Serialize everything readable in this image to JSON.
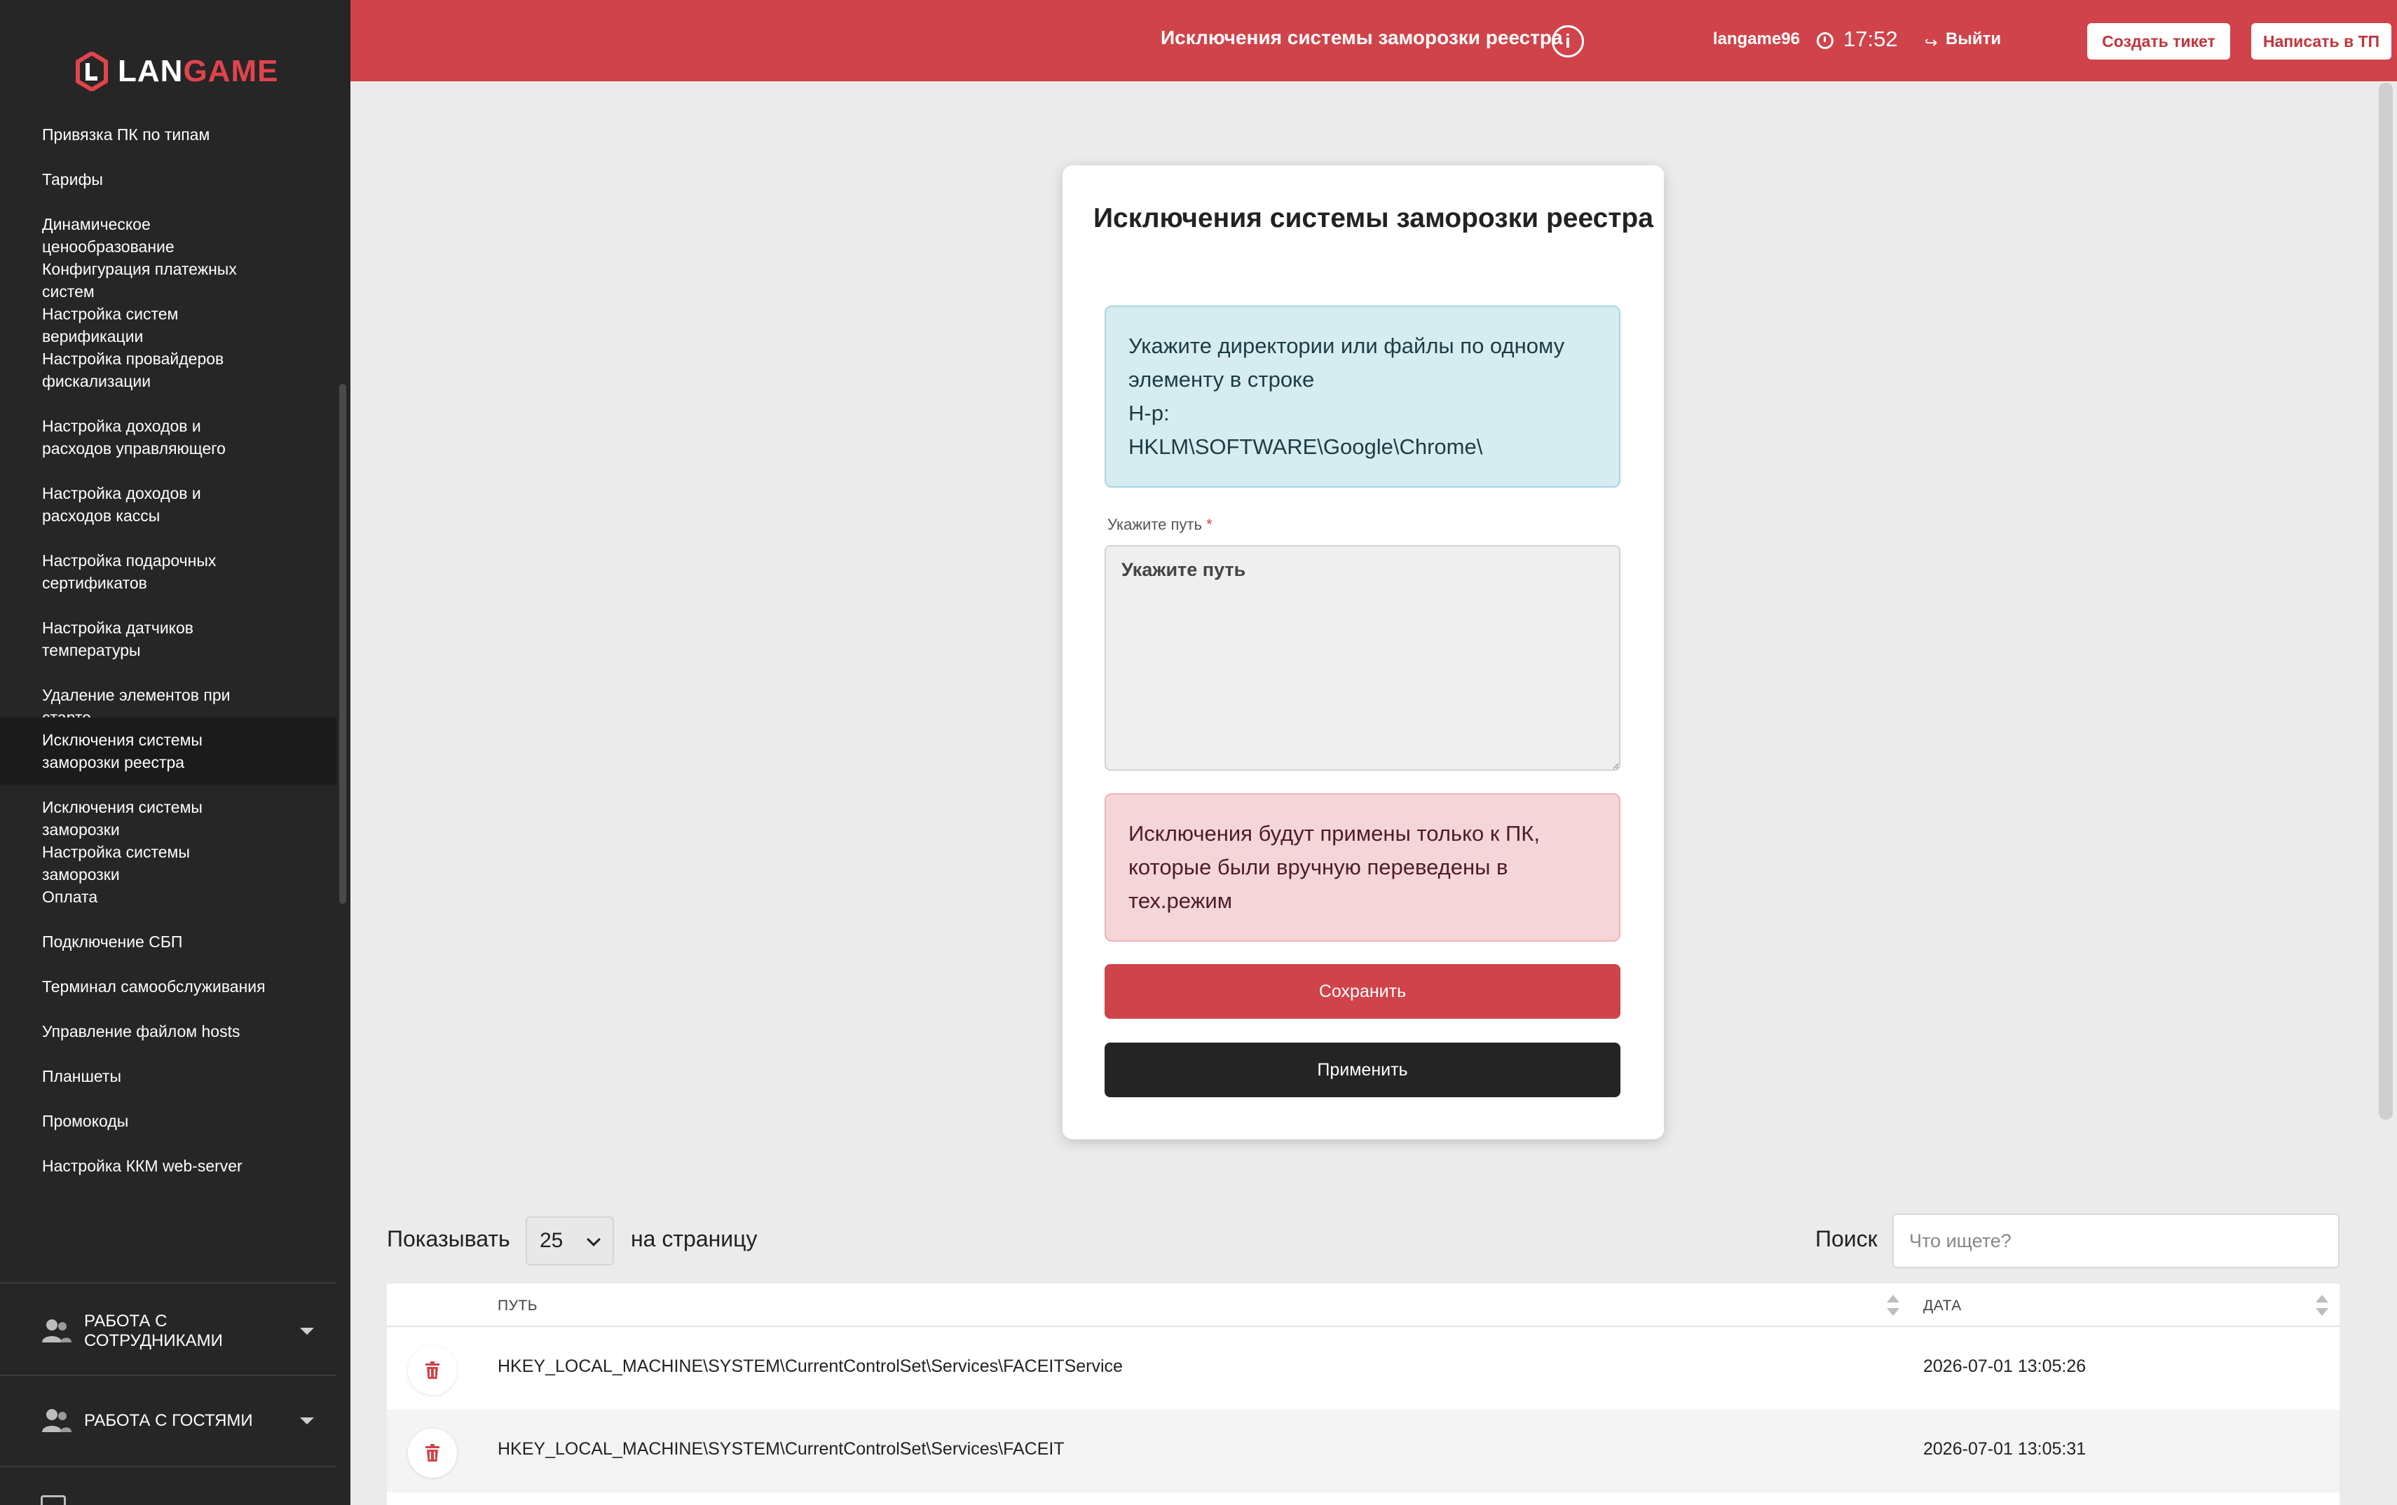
{
  "brand": {
    "logo_text_main": "LAN",
    "logo_text_accent": "GAME",
    "accent_color": "#d0434a"
  },
  "sidebar": {
    "items": [
      {
        "label": "Привязка ПК по типам",
        "active": false
      },
      {
        "label": "Тарифы",
        "active": false
      },
      {
        "label": "Динамическое ценообразование",
        "active": false
      },
      {
        "label": "Конфигурация платежных систем",
        "active": false
      },
      {
        "label": "Настройка систем верификации",
        "active": false
      },
      {
        "label": "Настройка провайдеров фискализации",
        "active": false
      },
      {
        "label": "Настройка доходов и расходов управляющего",
        "active": false
      },
      {
        "label": "Настройка доходов и расходов кассы",
        "active": false
      },
      {
        "label": "Настройка подарочных сертификатов",
        "active": false
      },
      {
        "label": "Настройка датчиков температуры",
        "active": false
      },
      {
        "label": "Удаление элементов при старте",
        "active": false
      },
      {
        "label": "Исключения системы заморозки реестра",
        "active": true
      },
      {
        "label": "Исключения системы заморозки",
        "active": false
      },
      {
        "label": "Настройка системы заморозки",
        "active": false
      },
      {
        "label": "Оплата",
        "active": false
      },
      {
        "label": "Подключение СБП",
        "active": false
      },
      {
        "label": "Терминал самообслуживания",
        "active": false
      },
      {
        "label": "Управление файлом hosts",
        "active": false
      },
      {
        "label": "Планшеты",
        "active": false
      },
      {
        "label": "Промокоды",
        "active": false
      },
      {
        "label": "Настройка ККМ web-server",
        "active": false
      }
    ],
    "sections": [
      {
        "label": "Работа с сотрудниками",
        "icon": "people-icon"
      },
      {
        "label": "Работа с гостями",
        "icon": "people-icon"
      }
    ]
  },
  "header": {
    "title": "Исключения системы заморозки реестра",
    "create_ticket_label": "Создать тикет",
    "write_support_label": "Написать в ТП",
    "username": "langame96",
    "time": "17:52",
    "logout_label": "Выйти"
  },
  "form": {
    "title": "Исключения системы заморозки реестра",
    "info_lines": [
      "Укажите директории или файлы по одному",
      "элементу в строке",
      "Н-р:",
      "HKLM\\SOFTWARE\\Google\\Chrome\\"
    ],
    "path_label": "Укажите путь",
    "path_required_mark": "*",
    "path_placeholder": "Укажите путь",
    "path_value": "",
    "warning_lines": [
      "Исключения будут примены только к ПК,",
      "которые были вручную переведены в",
      "тех.режим"
    ],
    "save_label": "Сохранить",
    "apply_label": "Применить"
  },
  "table_controls": {
    "show_label": "Показывать",
    "page_size": "25",
    "per_page_label": "на страницу",
    "search_label": "Поиск",
    "search_placeholder": "Что ищете?"
  },
  "table": {
    "columns": [
      "Путь",
      "Дата"
    ],
    "rows": [
      {
        "path": "HKEY_LOCAL_MACHINE\\SYSTEM\\CurrentControlSet\\Services\\FACEITService",
        "date": "2026-07-01 13:05:26"
      },
      {
        "path": "HKEY_LOCAL_MACHINE\\SYSTEM\\CurrentControlSet\\Services\\FACEIT",
        "date": "2026-07-01 13:05:31"
      }
    ]
  }
}
